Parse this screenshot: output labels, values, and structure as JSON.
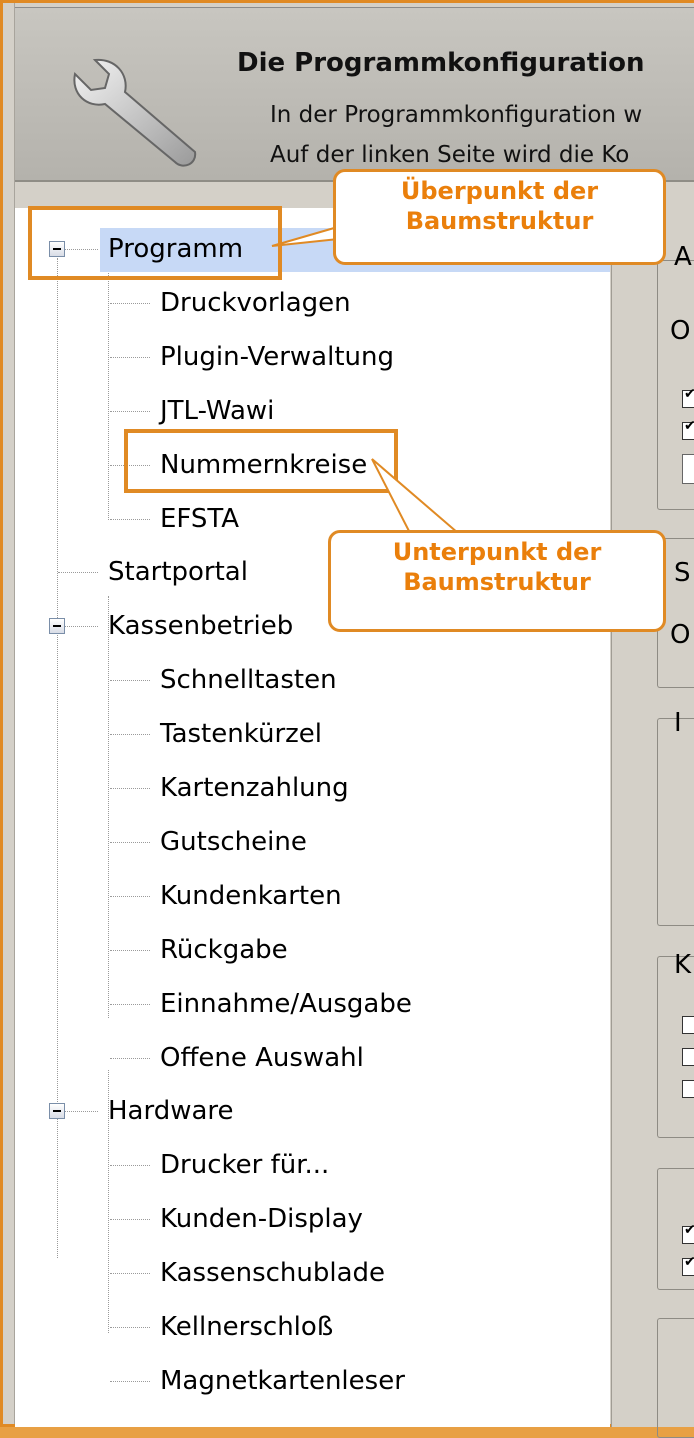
{
  "header": {
    "title": "Die Programmkonfiguration",
    "line1": "In der Programmkonfiguration w",
    "line2": "Auf der linken Seite wird die Ko",
    "icon": "wrench-icon"
  },
  "tree": {
    "items": [
      {
        "label": "Programm",
        "level": 0,
        "expanded": true,
        "selected": true
      },
      {
        "label": "Druckvorlagen",
        "level": 1
      },
      {
        "label": "Plugin-Verwaltung",
        "level": 1
      },
      {
        "label": "JTL-Wawi",
        "level": 1
      },
      {
        "label": "Nummernkreise",
        "level": 1
      },
      {
        "label": "EFSTA",
        "level": 1
      },
      {
        "label": "Startportal",
        "level": 0
      },
      {
        "label": "Kassenbetrieb",
        "level": 0,
        "expanded": true
      },
      {
        "label": "Schnelltasten",
        "level": 1
      },
      {
        "label": "Tastenkürzel",
        "level": 1
      },
      {
        "label": "Kartenzahlung",
        "level": 1
      },
      {
        "label": "Gutscheine",
        "level": 1
      },
      {
        "label": "Kundenkarten",
        "level": 1
      },
      {
        "label": "Rückgabe",
        "level": 1
      },
      {
        "label": "Einnahme/Ausgabe",
        "level": 1
      },
      {
        "label": "Offene Auswahl",
        "level": 1
      },
      {
        "label": "Hardware",
        "level": 0,
        "expanded": true
      },
      {
        "label": "Drucker für...",
        "level": 1
      },
      {
        "label": "Kunden-Display",
        "level": 1
      },
      {
        "label": "Kassenschublade",
        "level": 1
      },
      {
        "label": "Kellnerschloß",
        "level": 1
      },
      {
        "label": "Magnetkartenleser",
        "level": 1
      }
    ]
  },
  "callouts": {
    "top": {
      "line1": "Überpunkt der",
      "line2": "Baumstruktur"
    },
    "bottom": {
      "line1": "Unterpunkt der",
      "line2": "Baumstruktur"
    }
  },
  "right_panel": {
    "frag_a": "A",
    "frag_o1": "O",
    "frag_s": "S",
    "frag_o2": "O",
    "frag_i": "I",
    "frag_k": "K"
  },
  "colors": {
    "accent": "#e08a24",
    "callout_text": "#ea7f0b",
    "selection": "#c7d9f6"
  }
}
